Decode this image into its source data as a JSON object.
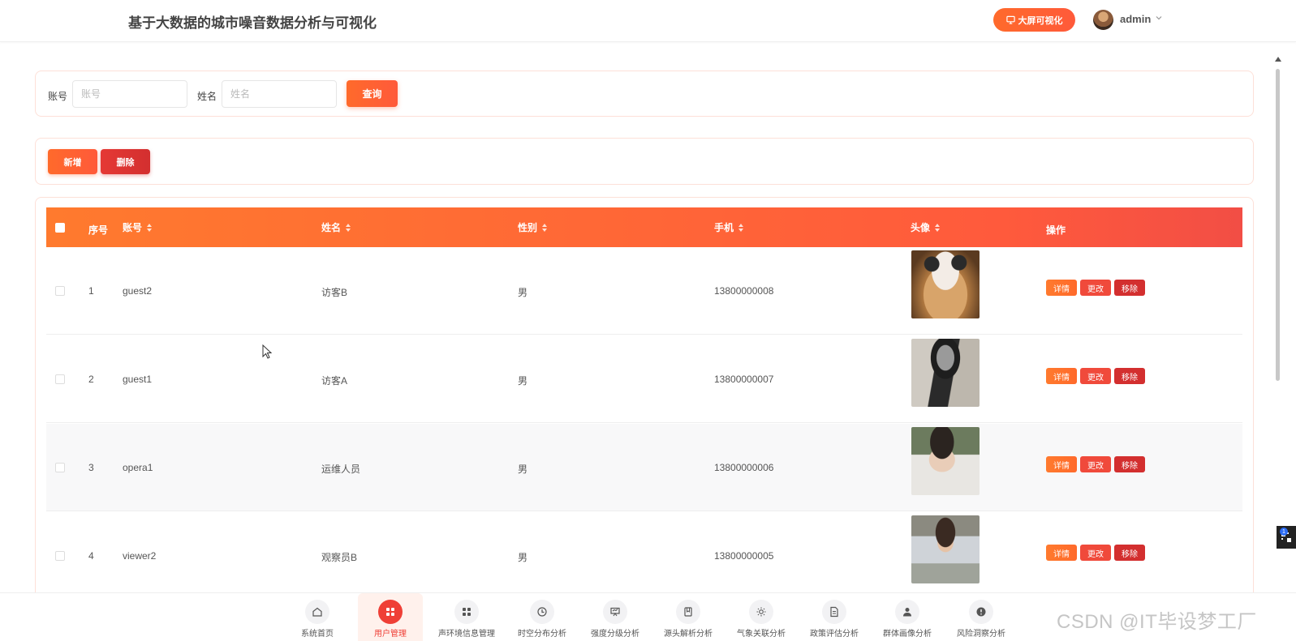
{
  "header": {
    "title": "基于大数据的城市噪音数据分析与可视化",
    "bigscreen_label": "大屏可视化",
    "user": "admin"
  },
  "search": {
    "account_label": "账号",
    "account_placeholder": "账号",
    "name_label": "姓名",
    "name_placeholder": "姓名",
    "query_label": "查询"
  },
  "actions": {
    "add_label": "新增",
    "delete_label": "删除"
  },
  "table": {
    "columns": {
      "index": "序号",
      "account": "账号",
      "name": "姓名",
      "gender": "性别",
      "phone": "手机",
      "avatar": "头像",
      "ops": "操作"
    },
    "op_labels": {
      "detail": "详情",
      "edit": "更改",
      "remove": "移除"
    },
    "rows": [
      {
        "index": "1",
        "account": "guest2",
        "name": "访客B",
        "gender": "男",
        "phone": "13800000008"
      },
      {
        "index": "2",
        "account": "guest1",
        "name": "访客A",
        "gender": "男",
        "phone": "13800000007"
      },
      {
        "index": "3",
        "account": "opera1",
        "name": "运维人员",
        "gender": "男",
        "phone": "13800000006"
      },
      {
        "index": "4",
        "account": "viewer2",
        "name": "观察员B",
        "gender": "男",
        "phone": "13800000005"
      }
    ]
  },
  "bottom_nav": [
    {
      "label": "系统首页",
      "icon": "home-icon"
    },
    {
      "label": "用户管理",
      "icon": "grid-icon",
      "active": true
    },
    {
      "label": "声环境信息管理",
      "icon": "grid-icon"
    },
    {
      "label": "时空分布分析",
      "icon": "clock-icon"
    },
    {
      "label": "强度分级分析",
      "icon": "presentation-icon"
    },
    {
      "label": "源头解析分析",
      "icon": "book-icon"
    },
    {
      "label": "气象关联分析",
      "icon": "sun-icon"
    },
    {
      "label": "政策评估分析",
      "icon": "document-icon"
    },
    {
      "label": "群体画像分析",
      "icon": "person-icon"
    },
    {
      "label": "风险洞察分析",
      "icon": "alert-icon"
    }
  ],
  "watermark": "CSDN @IT毕设梦工厂",
  "colors": {
    "accent": "#ff6a2b",
    "danger": "#d32f2f",
    "active_nav": "#ef3f36"
  }
}
